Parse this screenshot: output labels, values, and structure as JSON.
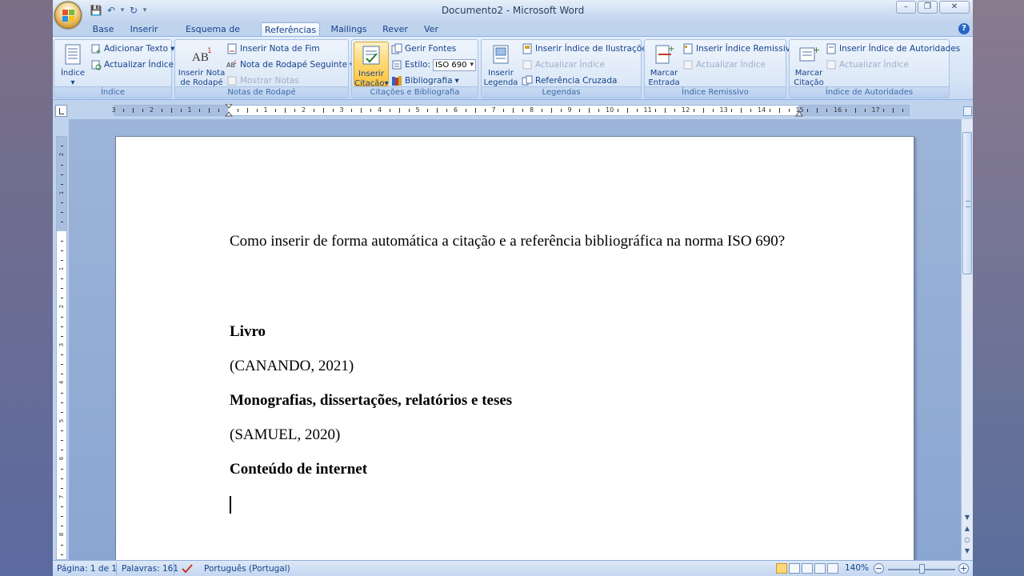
{
  "window": {
    "title": "Documento2 - Microsoft Word"
  },
  "tabs": [
    {
      "label": "Base"
    },
    {
      "label": "Inserir"
    },
    {
      "label": "Esquema de Página"
    },
    {
      "label": "Referências",
      "active": true
    },
    {
      "label": "Mailings"
    },
    {
      "label": "Rever"
    },
    {
      "label": "Ver"
    }
  ],
  "ribbon": {
    "indice": {
      "group_label": "Índice",
      "indice_button": "Índice",
      "adicionar_texto": "Adicionar Texto",
      "actualizar_indice": "Actualizar Índice"
    },
    "notas": {
      "group_label": "Notas de Rodapé",
      "inserir_nota_line1": "Inserir Nota",
      "inserir_nota_line2": "de Rodapé",
      "inserir_nota_fim": "Inserir Nota de Fim",
      "nota_rodape_seguinte": "Nota de Rodapé Seguinte",
      "mostrar_notas": "Mostrar Notas"
    },
    "citacoes": {
      "group_label": "Citações e Bibliografia",
      "inserir_line1": "Inserir",
      "inserir_line2": "Citação",
      "gerir_fontes": "Gerir Fontes",
      "estilo_label": "Estilo:",
      "estilo_value": "ISO 690",
      "bibliografia": "Bibliografia"
    },
    "legendas": {
      "group_label": "Legendas",
      "inserir_line1": "Inserir",
      "inserir_line2": "Legenda",
      "inserir_indice_ilustracoes": "Inserir Índice de Ilustrações",
      "actualizar_indice": "Actualizar Índice",
      "referencia_cruzada": "Referência Cruzada"
    },
    "remissivo": {
      "group_label": "Índice Remissivo",
      "marcar_line1": "Marcar",
      "marcar_line2": "Entrada",
      "inserir_indice_remissivo": "Inserir Índice Remissivo",
      "actualizar_indice": "Actualizar Índice"
    },
    "autoridades": {
      "group_label": "Índice de Autoridades",
      "marcar_line1": "Marcar",
      "marcar_line2": "Citação",
      "inserir_indice_autoridades": "Inserir Índice de Autoridades",
      "actualizar_indice": "Actualizar Índice"
    }
  },
  "ruler": {
    "numbers": [
      "3",
      "2",
      "1",
      "1",
      "2",
      "3",
      "4",
      "5",
      "6",
      "7",
      "8",
      "9",
      "10",
      "11",
      "12",
      "13",
      "14",
      "15",
      "16",
      "17"
    ],
    "vertical_numbers": [
      "2",
      "1",
      "1",
      "2",
      "3",
      "4",
      "5",
      "6",
      "7",
      "8"
    ]
  },
  "document": {
    "question": "Como inserir de forma automática a citação e a referência bibliográfica na norma ISO 690?",
    "heading_livro": "Livro",
    "cite_livro": "(CANANDO, 2021)",
    "heading_mono": "Monografias, dissertações, relatórios e teses",
    "cite_mono": "(SAMUEL, 2020)",
    "heading_internet": "Conteúdo de internet"
  },
  "status": {
    "page": "Página: 1 de 1",
    "words": "Palavras: 161",
    "language": "Português (Portugal)",
    "zoom": "140%"
  },
  "colors": {
    "ribbon_accent": "#15428b",
    "active_button": "#ffc43b"
  }
}
